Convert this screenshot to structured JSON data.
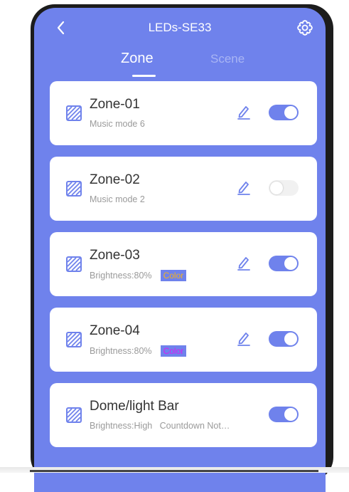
{
  "header": {
    "title": "LEDs-SE33"
  },
  "tabs": [
    {
      "label": "Zone",
      "active": true
    },
    {
      "label": "Scene",
      "active": false
    }
  ],
  "zones": [
    {
      "name": "Zone-01",
      "subtitle": "Music mode 6",
      "color_label": "",
      "enabled": true
    },
    {
      "name": "Zone-02",
      "subtitle": "Music mode 2",
      "color_label": "",
      "enabled": false
    },
    {
      "name": "Zone-03",
      "subtitle": "Brightness:80%",
      "color_label": "Color",
      "color_value": "#f5b21c",
      "enabled": true
    },
    {
      "name": "Zone-04",
      "subtitle": "Brightness:80%",
      "color_label": "Color",
      "color_value": "#d81ef2",
      "enabled": true
    },
    {
      "name": "Dome/light Bar",
      "subtitle": "Brightness:High   Countdown Not…",
      "color_label": "",
      "enabled": true
    }
  ],
  "colors": {
    "accent": "#6f82ec",
    "toggle_off": "#f1f1f1",
    "icon": "#6f82ec"
  }
}
